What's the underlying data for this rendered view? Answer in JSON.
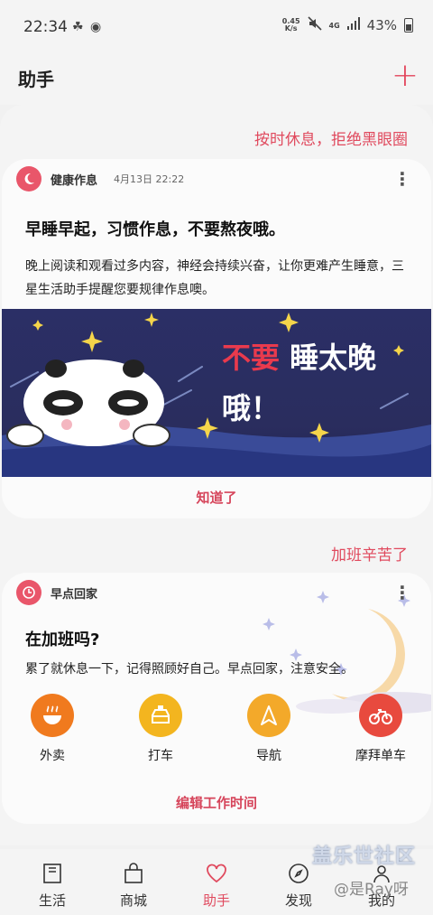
{
  "status_bar": {
    "time": "22:34",
    "net_speed_value": "0.45",
    "net_speed_unit": "K/s",
    "network": "4G",
    "battery": "43%"
  },
  "header": {
    "title": "助手",
    "add_icon": "plus-icon"
  },
  "section1": {
    "heading": "按时休息，拒绝黑眼圈"
  },
  "card1": {
    "app_name": "健康作息",
    "date": "4月13日 22:22",
    "title": "早睡早起，习惯作息，不要熬夜哦。",
    "body": "晚上阅读和观看过多内容，神经会持续兴奋，让你更难产生睡意，三星生活助手提醒您要规律作息噢。",
    "banner_red": "不要",
    "banner_white": "睡太晚",
    "banner_line2": "哦！",
    "action": "知道了"
  },
  "section2": {
    "heading": "加班辛苦了"
  },
  "card2": {
    "app_name": "早点回家",
    "title": "在加班吗?",
    "body": "累了就休息一下，记得照顾好自己。早点回家，注意安全。",
    "shortcuts": [
      {
        "label": "外卖",
        "icon": "bowl-icon",
        "color": "#f07a1e"
      },
      {
        "label": "打车",
        "icon": "taxi-icon",
        "color": "#f3b51f"
      },
      {
        "label": "导航",
        "icon": "navigation-icon",
        "color": "#f3a92a"
      },
      {
        "label": "摩拜单车",
        "icon": "bike-icon",
        "color": "#e84a3e"
      }
    ],
    "action": "编辑工作时间"
  },
  "bottom_nav": {
    "items": [
      {
        "label": "生活",
        "icon": "bookmark-icon"
      },
      {
        "label": "商城",
        "icon": "shopping-bag-icon"
      },
      {
        "label": "助手",
        "icon": "heart-icon",
        "active": true
      },
      {
        "label": "发现",
        "icon": "compass-icon"
      },
      {
        "label": "我的",
        "icon": "person-icon"
      }
    ]
  },
  "watermark": {
    "text": "盖乐世社区",
    "user": "@是Ray呀"
  },
  "colors": {
    "accent": "#e04a5e",
    "banner_bg": "#2b2f66"
  }
}
